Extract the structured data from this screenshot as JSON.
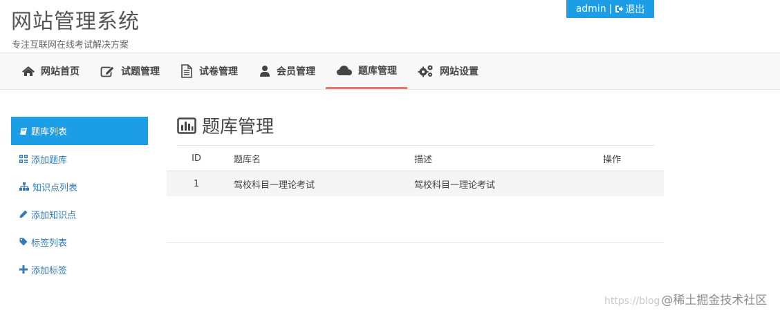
{
  "header": {
    "title": "网站管理系统",
    "subtitle": "专注互联网在线考试解决方案",
    "username": "admin",
    "separator": "|",
    "logout_label": "退出"
  },
  "nav": {
    "items": [
      {
        "label": "网站首页",
        "icon": "home-icon"
      },
      {
        "label": "试题管理",
        "icon": "edit-icon"
      },
      {
        "label": "试卷管理",
        "icon": "file-icon"
      },
      {
        "label": "会员管理",
        "icon": "user-icon"
      },
      {
        "label": "题库管理",
        "icon": "cloud-icon",
        "active": true
      },
      {
        "label": "网站设置",
        "icon": "gears-icon"
      }
    ]
  },
  "sidebar": {
    "items": [
      {
        "label": "题库列表",
        "icon": "book-icon",
        "active": true
      },
      {
        "label": "添加题库",
        "icon": "qrcode-icon"
      },
      {
        "label": "知识点列表",
        "icon": "sitemap-icon"
      },
      {
        "label": "添加知识点",
        "icon": "pencil-icon"
      },
      {
        "label": "标签列表",
        "icon": "tag-icon"
      },
      {
        "label": "添加标签",
        "icon": "plus-icon"
      }
    ]
  },
  "main": {
    "heading": "题库管理",
    "heading_icon": "bar-chart-icon",
    "table": {
      "columns": [
        "ID",
        "题库名",
        "描述",
        "操作"
      ],
      "rows": [
        {
          "id": "1",
          "name": "驾校科目一理论考试",
          "description": "驾校科目一理论考试",
          "ops": ""
        }
      ]
    }
  },
  "watermark": {
    "url_text": "https://blog",
    "site_text": "@稀土掘金技术社区"
  },
  "colors": {
    "accent_blue": "#1b9ee6",
    "active_tab_underline": "#e9776a",
    "link_blue": "#337ab7"
  }
}
